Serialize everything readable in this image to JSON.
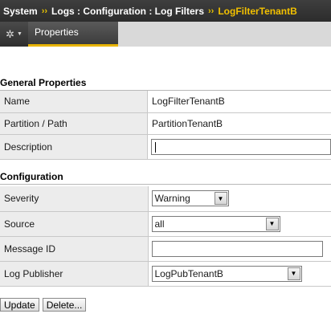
{
  "breadcrumb": {
    "items": [
      "System",
      "Logs : Configuration : Log Filters"
    ],
    "current": "LogFilterTenantB",
    "separator": "››"
  },
  "tabs": {
    "menu_icon": "gear-icon",
    "active_label": "Properties"
  },
  "general": {
    "heading": "General Properties",
    "rows": [
      {
        "label": "Name",
        "value": "LogFilterTenantB"
      },
      {
        "label": "Partition / Path",
        "value": "PartitionTenantB"
      }
    ],
    "description_label": "Description",
    "description_value": ""
  },
  "configuration": {
    "heading": "Configuration",
    "severity_label": "Severity",
    "severity_value": "Warning",
    "source_label": "Source",
    "source_value": "all",
    "message_id_label": "Message ID",
    "message_id_value": "",
    "log_publisher_label": "Log Publisher",
    "log_publisher_value": "LogPubTenantB"
  },
  "actions": {
    "update": "Update",
    "delete": "Delete..."
  },
  "colors": {
    "header_bg": "#333333",
    "accent": "#f2c000",
    "label_cell_bg": "#ececec"
  }
}
